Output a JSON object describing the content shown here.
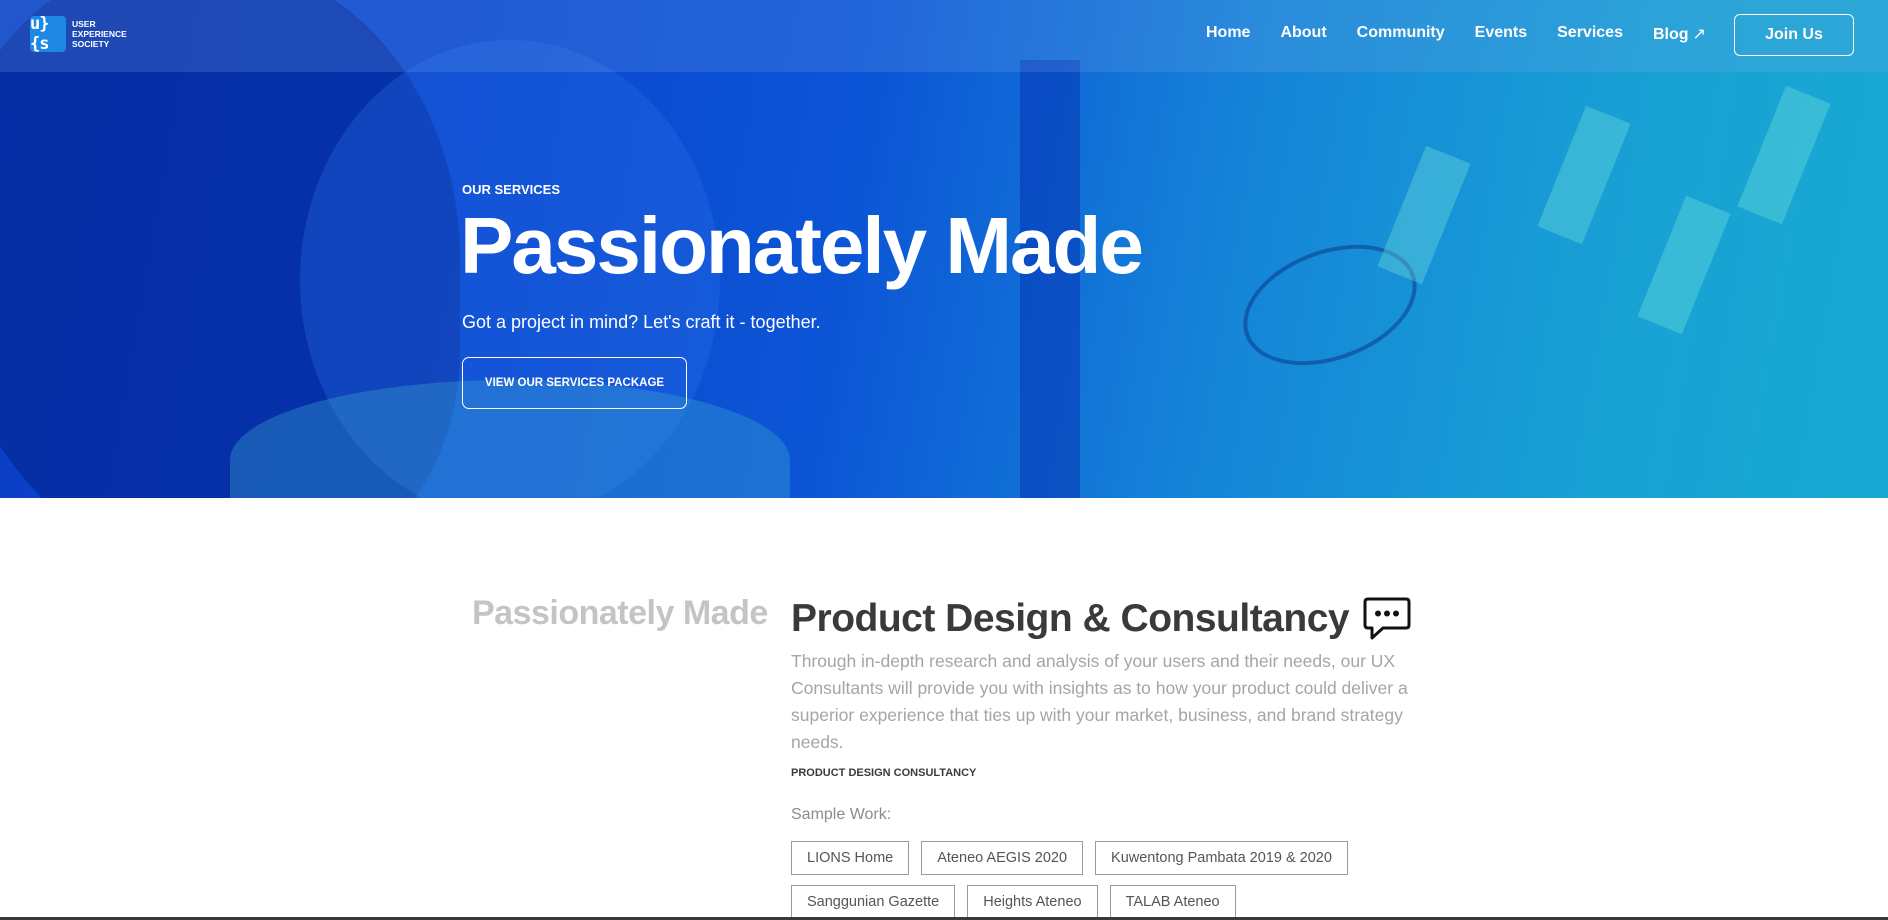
{
  "brand": {
    "logo_mark": "u}{s",
    "logo_lines": [
      "USER",
      "EXPERIENCE",
      "SOCIETY"
    ]
  },
  "nav": {
    "items": [
      {
        "label": "Home"
      },
      {
        "label": "About"
      },
      {
        "label": "Community"
      },
      {
        "label": "Events"
      },
      {
        "label": "Services"
      },
      {
        "label": "Blog",
        "external_icon": "↗"
      }
    ],
    "join_label": "Join Us"
  },
  "hero": {
    "eyebrow": "OUR SERVICES",
    "title": "Passionately Made",
    "subtitle": "Got a project in mind? Let's craft it - together.",
    "cta_label": "VIEW OUR SERVICES PACKAGE"
  },
  "service": {
    "side_label": "Passionately Made",
    "title": "Product Design & Consultancy",
    "icon": "speech-bubble-icon",
    "description": "Through in-depth research and analysis of your users and their needs, our UX Consultants will provide you with insights as to how your product could deliver a superior experience that ties up with your market, business, and brand strategy needs.",
    "tag": "PRODUCT DESIGN CONSULTANCY",
    "sample_label": "Sample Work:",
    "samples": [
      "LIONS Home",
      "Ateneo AEGIS 2020",
      "Kuwentong Pambata 2019 & 2020",
      "Sanggunian Gazette",
      "Heights Ateneo",
      "TALAB Ateneo"
    ]
  },
  "colors": {
    "hero_start": "#0b3fc4",
    "hero_end": "#17a9d1",
    "heading": "#3a3a3a",
    "muted": "#a5a5a5"
  }
}
